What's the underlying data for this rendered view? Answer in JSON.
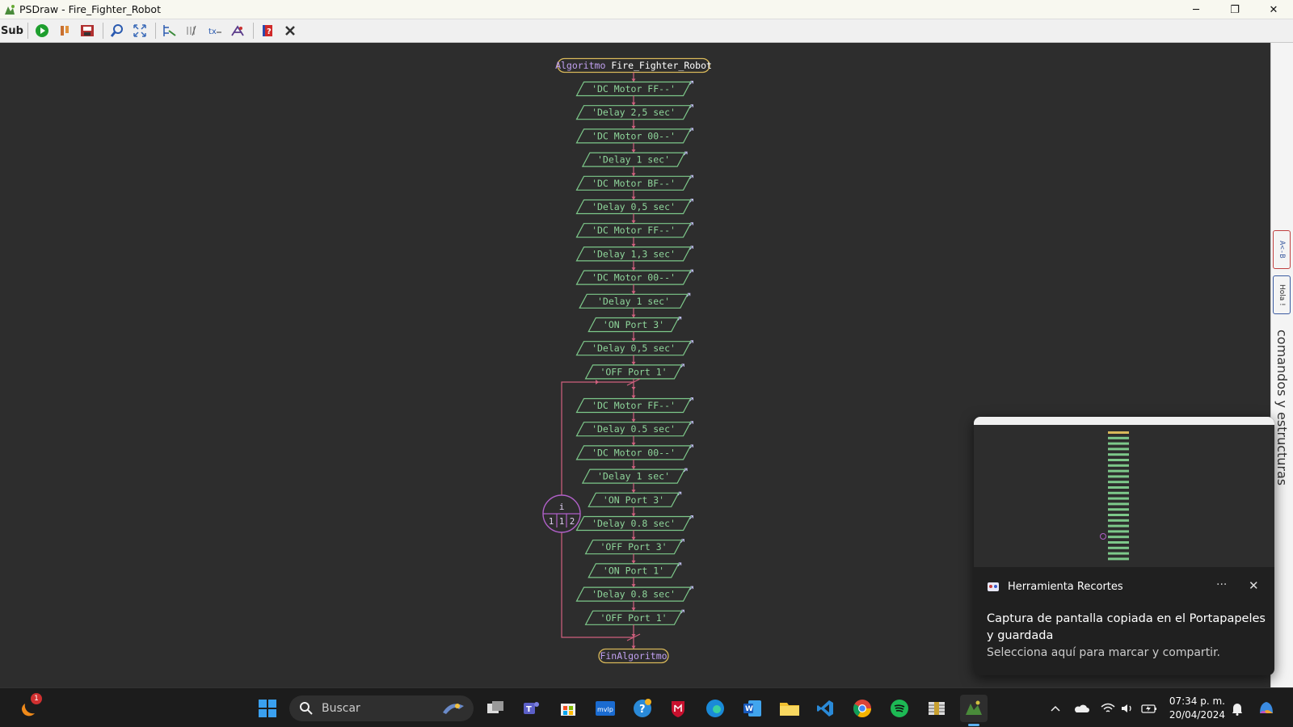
{
  "window": {
    "title": "PSDraw - Fire_Fighter_Robot",
    "min_label": "─",
    "restore_label": "❐",
    "close_label": "✕"
  },
  "toolbar": {
    "sub_label": "Sub",
    "buttons": [
      "sub-button",
      "run-icon",
      "step-icon",
      "save-image-icon",
      "zoom-icon",
      "fit-icon",
      "expand-icon",
      "variables-icon",
      "tree-icon",
      "export-icon",
      "help-icon",
      "close-tool-icon"
    ]
  },
  "flowchart": {
    "start": "Algoritmo Fire_Fighter_Robot",
    "start_keyword": "Algoritmo",
    "start_name": "Fire_Fighter_Robot",
    "before_loop": [
      "'DC Motor FF--'",
      "'Delay 2,5 sec'",
      "'DC Motor 00--'",
      "'Delay 1 sec'",
      "'DC Motor BF--'",
      "'Delay 0,5 sec'",
      "'DC Motor FF--'",
      "'Delay 1,3 sec'",
      "'DC Motor 00--'",
      "'Delay  1 sec'",
      "'ON Port 3'",
      "'Delay 0,5 sec'",
      "'OFF Port 1'"
    ],
    "loop": {
      "variable": "i",
      "start": "1",
      "step": "1",
      "end": "2",
      "body": [
        "'DC Motor FF--'",
        "'Delay 0.5 sec'",
        "'DC Motor 00--'",
        "'Delay 1 sec'",
        "'ON Port 3'",
        "'Delay 0.8 sec'",
        "'OFF Port 3'",
        "'ON Port 1'",
        "'Delay 0.8 sec'",
        "'OFF Port 1'"
      ]
    },
    "end": "FinAlgoritmo"
  },
  "side_panel": {
    "label": "comandos y estructuras",
    "tab1": "A<-B",
    "tab2": "Hola !"
  },
  "toast": {
    "app": "Herramienta Recortes",
    "message": "Captura de pantalla copiada en el Portapapeles y guardada",
    "sub": "Selecciona aquí para marcar y compartir.",
    "more": "···",
    "close": "✕"
  },
  "taskbar": {
    "search_placeholder": "Buscar",
    "badge": "1",
    "time": "07:34 p. m.",
    "date": "20/04/2024"
  },
  "colors": {
    "flow_green": "#8ed59a",
    "flow_stroke": "#7dc88a",
    "connector": "#d0607e",
    "loop": "#b060c8",
    "terminal": "#d8b85a"
  }
}
